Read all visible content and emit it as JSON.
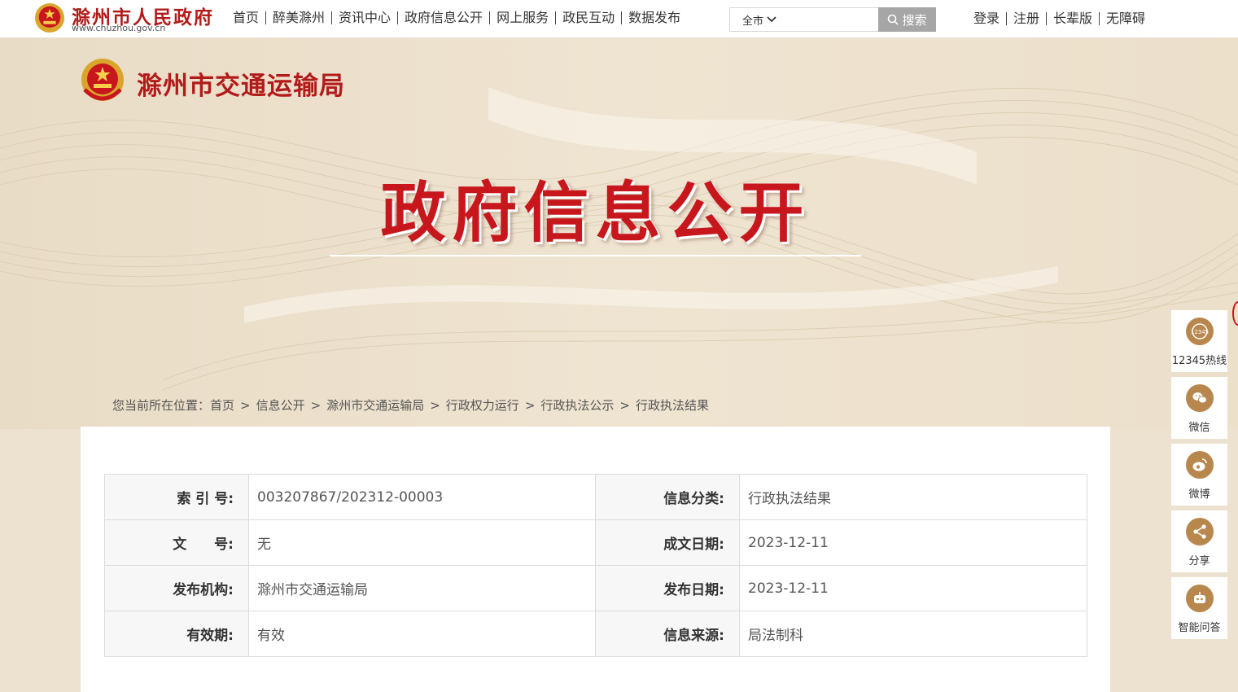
{
  "site": {
    "name": "滁州市人民政府",
    "url": "www.chuzhou.gov.cn"
  },
  "nav": {
    "items": [
      "首页",
      "醉美滁州",
      "资讯中心",
      "政府信息公开",
      "网上服务",
      "政民互动",
      "数据发布"
    ]
  },
  "search": {
    "scope": "全市",
    "placeholder": "",
    "button_label": "搜索"
  },
  "user_links": [
    "登录",
    "注册",
    "长辈版",
    "无障碍"
  ],
  "banner": {
    "bureau_name": "滁州市交通运输局",
    "title": "政府信息公开"
  },
  "breadcrumb": {
    "prefix": "您当前所在位置：",
    "items": [
      "首页",
      "信息公开",
      "滁州市交通运输局",
      "行政权力运行",
      "行政执法公示",
      "行政执法结果"
    ]
  },
  "meta": {
    "rows": [
      {
        "label1": "索 引 号:",
        "value1": "003207867/202312-00003",
        "label2": "信息分类:",
        "value2": "行政执法结果"
      },
      {
        "label1": "文　　号:",
        "value1": "无",
        "label2": "成文日期:",
        "value2": "2023-12-11"
      },
      {
        "label1": "发布机构:",
        "value1": "滁州市交通运输局",
        "label2": "发布日期:",
        "value2": "2023-12-11"
      },
      {
        "label1": "有效期:",
        "value1": "有效",
        "label2": "信息来源:",
        "value2": "局法制科"
      }
    ]
  },
  "float_bar": {
    "items": [
      {
        "label": "12345热线",
        "icon": "hotline-12345-icon"
      },
      {
        "label": "微信",
        "icon": "wechat-icon"
      },
      {
        "label": "微博",
        "icon": "weibo-icon"
      },
      {
        "label": "分享",
        "icon": "share-icon"
      },
      {
        "label": "智能问答",
        "icon": "robot-icon"
      }
    ]
  },
  "colors": {
    "brand_red": "#c8161d",
    "background": "#ede2cf",
    "icon_gold": "#b8874d"
  }
}
